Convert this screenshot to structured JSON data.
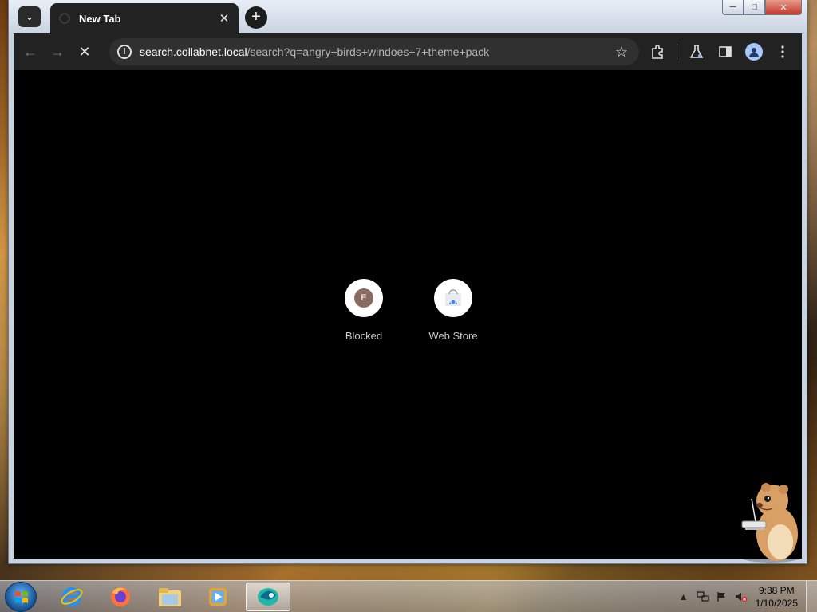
{
  "browser": {
    "tab": {
      "title": "New Tab",
      "close_glyph": "✕"
    },
    "new_tab_glyph": "+",
    "tab_search_glyph": "⌄",
    "window_controls": {
      "minimize": "─",
      "maximize": "□",
      "close": "✕"
    },
    "nav": {
      "back": "←",
      "forward": "→",
      "stop": "✕"
    },
    "address": {
      "host": "search.collabnet.local",
      "path": "/search?q=angry+birds+windoes+7+theme+pack"
    },
    "toolbar_icons": [
      "extensions-icon",
      "labs-icon",
      "side-panel-icon",
      "profile-icon",
      "menu-icon"
    ]
  },
  "new_tab_page": {
    "background": "#000000",
    "shortcuts": [
      {
        "label": "Blocked",
        "letter": "E"
      },
      {
        "label": "Web Store"
      }
    ]
  },
  "taskbar": {
    "apps": [
      "internet-explorer-icon",
      "firefox-icon",
      "file-explorer-icon",
      "media-player-icon",
      "browser-icon"
    ],
    "clock": {
      "time": "9:38 PM",
      "date": "1/10/2025"
    }
  }
}
